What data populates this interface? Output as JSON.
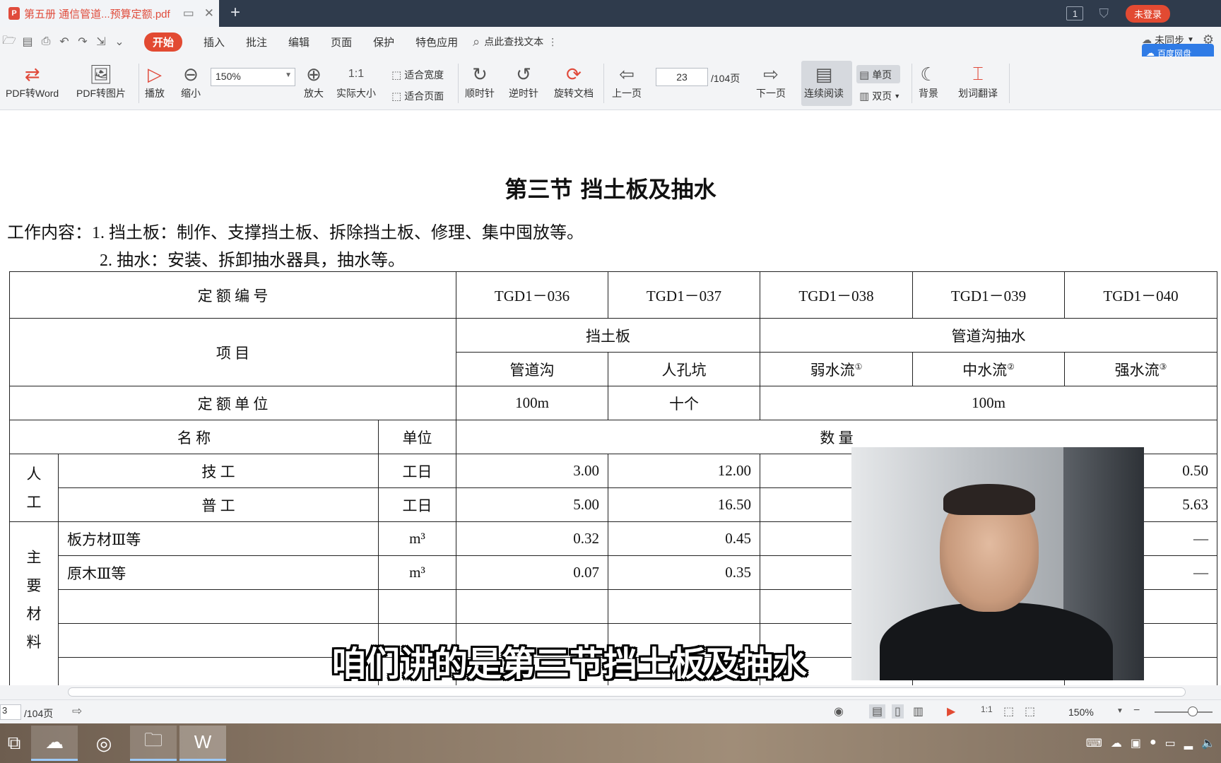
{
  "tab": {
    "title": "第五册 通信管道...预算定额.pdf",
    "icon": "pdf-file-icon"
  },
  "topright": {
    "badge": "1",
    "login": "未登录"
  },
  "menubar": {
    "items": [
      "开始",
      "插入",
      "批注",
      "编辑",
      "页面",
      "保护",
      "特色应用"
    ],
    "search": "点此查找文本",
    "sync": "未同步",
    "cloud_label": "百度网盘"
  },
  "toolbar": {
    "pdf_to_word": "PDF转Word",
    "pdf_to_image": "PDF转图片",
    "play": "播放",
    "zoom_out": "缩小",
    "zoom_value": "150%",
    "zoom_in": "放大",
    "actual_size": "实际大小",
    "fit_width": "适合宽度",
    "fit_page": "适合页面",
    "clockwise": "顺时针",
    "counterclockwise": "逆时针",
    "rotate_doc": "旋转文档",
    "prev_page": "上一页",
    "page_current": "23",
    "page_total": "/104页",
    "next_page": "下一页",
    "continuous": "连续阅读",
    "single_page": "单页",
    "double_page": "双页",
    "background": "背景",
    "translate": "划词翻译"
  },
  "document": {
    "title": "第三节    挡土板及抽水",
    "work_label": "工作内容：",
    "work_1": "1. 挡土板：制作、支撑挡土板、拆除挡土板、修理、集中囤放等。",
    "work_2": "2. 抽水：安装、拆卸抽水器具，抽水等。",
    "table": {
      "code_label": "定    额    编    号",
      "codes": [
        "TGD1－036",
        "TGD1－037",
        "TGD1－038",
        "TGD1－039",
        "TGD1－040"
      ],
      "item_label": "项          目",
      "group_1": "挡土板",
      "group_2": "管道沟抽水",
      "sub": [
        "管道沟",
        "人孔坑",
        "弱水流",
        "中水流",
        "强水流"
      ],
      "sup": [
        "①",
        "②",
        "③"
      ],
      "unit_label": "定    额    单    位",
      "units": [
        "100m",
        "十个",
        "100m"
      ],
      "name_label": "名        称",
      "unit_col": "单位",
      "qty_label": "数                    量",
      "labor": "人工",
      "labor_rows": [
        {
          "name": "技        工",
          "unit": "工日",
          "v1": "3.00",
          "v2": "12.00",
          "v5": "0.50"
        },
        {
          "name": "普        工",
          "unit": "工日",
          "v1": "5.00",
          "v2": "16.50",
          "v5": "5.63"
        }
      ],
      "material": "主要材料",
      "material_rows": [
        {
          "name": "板方材Ⅲ等",
          "unit": "m³",
          "v1": "0.32",
          "v2": "0.45",
          "v5": "—"
        },
        {
          "name": "原木Ⅲ等",
          "unit": "m³",
          "v1": "0.07",
          "v2": "0.35",
          "v5": "—"
        }
      ]
    }
  },
  "subtitle": "咱们讲的是第三节挡土板及抽水",
  "statusbar": {
    "page": "3",
    "total": "/104页",
    "zoom": "150%"
  }
}
